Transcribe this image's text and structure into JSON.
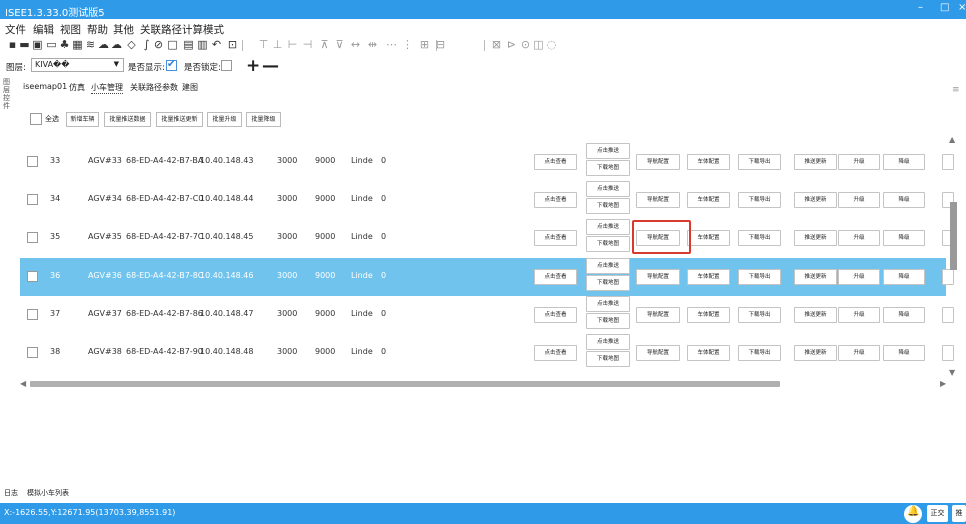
{
  "window": {
    "title": "ISEE1.3.33.0测试版5",
    "minimize": "–",
    "maximize": "□",
    "close": "×"
  },
  "menu": [
    "文件",
    "编辑",
    "视图",
    "帮助",
    "其他",
    "关联路径计算模式"
  ],
  "toolbar_icons": [
    {
      "name": "new-icon",
      "glyph": "▪"
    },
    {
      "name": "open-icon",
      "glyph": "▬"
    },
    {
      "name": "save-icon",
      "glyph": "▣"
    },
    {
      "name": "image-icon",
      "glyph": "▭"
    },
    {
      "name": "tree-icon",
      "glyph": "♣"
    },
    {
      "name": "grid-icon",
      "glyph": "▦"
    },
    {
      "name": "layers-icon",
      "glyph": "≋"
    },
    {
      "name": "cloud-download-icon",
      "glyph": "☁"
    },
    {
      "name": "cloud-upload-icon",
      "glyph": "☁"
    },
    {
      "name": "node-icon",
      "glyph": "◇"
    },
    {
      "name": "curve-icon",
      "glyph": "∫"
    },
    {
      "name": "forbid-icon",
      "glyph": "⊘"
    },
    {
      "name": "rect-icon",
      "glyph": "□"
    },
    {
      "name": "copy-icon",
      "glyph": "▤"
    },
    {
      "name": "delete-icon",
      "glyph": "▥"
    },
    {
      "name": "undo-icon",
      "glyph": "↶"
    },
    {
      "name": "zoom-icon",
      "glyph": "⊡"
    }
  ],
  "toolbar_icons_gray": [
    {
      "name": "align-top-icon",
      "glyph": "⊤"
    },
    {
      "name": "align-bottom-icon",
      "glyph": "⊥"
    },
    {
      "name": "align-left-icon",
      "glyph": "⊢"
    },
    {
      "name": "align-right-icon",
      "glyph": "⊣"
    },
    {
      "name": "align-vcenter-icon",
      "glyph": "⊼"
    },
    {
      "name": "align-vmid-icon",
      "glyph": "⊽"
    },
    {
      "name": "distribute-h-icon",
      "glyph": "↔"
    },
    {
      "name": "distribute-hc-icon",
      "glyph": "⇹"
    },
    {
      "name": "more-h-icon",
      "glyph": "⋯"
    },
    {
      "name": "more-v-icon",
      "glyph": "⋮"
    },
    {
      "name": "group-icon",
      "glyph": "⊞"
    },
    {
      "name": "ungroup-icon",
      "glyph": "⊟"
    },
    {
      "name": "network-icon",
      "glyph": "⊠"
    },
    {
      "name": "play-icon",
      "glyph": "⊳"
    },
    {
      "name": "record-icon",
      "glyph": "⊙"
    },
    {
      "name": "book-icon",
      "glyph": "◫"
    },
    {
      "name": "check-icon",
      "glyph": "◌"
    }
  ],
  "layerbar": {
    "layer_label": "图层:",
    "layer_value": "KIVA��",
    "show_label": "是否显示:",
    "show_checked": true,
    "lock_label": "是否锁定:",
    "lock_checked": false,
    "plus": "+",
    "minus": "—"
  },
  "sidebar_label": "图层控件",
  "tabs": [
    "iseemap01",
    "仿真",
    "小车管理",
    "关联路径参数",
    "建图"
  ],
  "active_tab": 2,
  "actions": {
    "select_all": "全选",
    "buttons": [
      "新增车辆",
      "批量推送数据",
      "批量推送更新",
      "批量升级",
      "批量降级"
    ]
  },
  "row_buttons": {
    "view": "点击查看",
    "push": "点击推送",
    "download_map": "下载地图",
    "nav_config": "导航配置",
    "body_config": "车体配置",
    "download_export": "下载导出",
    "push_update": "推送更新",
    "upgrade": "升级",
    "downgrade": "降级"
  },
  "vehicles": [
    {
      "id": "33",
      "name": "AGV#33",
      "mac": "68-ED-A4-42-B7-BA",
      "ip": "10.40.148.43",
      "v1": "3000",
      "v2": "9000",
      "brand": "Linde",
      "status": "0"
    },
    {
      "id": "34",
      "name": "AGV#34",
      "mac": "68-ED-A4-42-B7-C0",
      "ip": "10.40.148.44",
      "v1": "3000",
      "v2": "9000",
      "brand": "Linde",
      "status": "0"
    },
    {
      "id": "35",
      "name": "AGV#35",
      "mac": "68-ED-A4-42-B7-7C",
      "ip": "10.40.148.45",
      "v1": "3000",
      "v2": "9000",
      "brand": "Linde",
      "status": "0"
    },
    {
      "id": "36",
      "name": "AGV#36",
      "mac": "68-ED-A4-42-B7-8C",
      "ip": "10.40.148.46",
      "v1": "3000",
      "v2": "9000",
      "brand": "Linde",
      "status": "0",
      "selected": true
    },
    {
      "id": "37",
      "name": "AGV#37",
      "mac": "68-ED-A4-42-B7-86",
      "ip": "10.40.148.47",
      "v1": "3000",
      "v2": "9000",
      "brand": "Linde",
      "status": "0"
    },
    {
      "id": "38",
      "name": "AGV#38",
      "mac": "68-ED-A4-42-B7-90",
      "ip": "10.40.148.48",
      "v1": "3000",
      "v2": "9000",
      "brand": "Linde",
      "status": "0"
    }
  ],
  "bottom_tabs": [
    "日志",
    "模拟小车列表"
  ],
  "status": {
    "coords": "X:-1626.55,Y:12671.95(13703.39,8551.91)",
    "btn1": "正交",
    "btn2": "推"
  },
  "colors": {
    "accent": "#2f9be8",
    "selected_row": "#6fc3ec",
    "highlight": "#d93a2e"
  }
}
